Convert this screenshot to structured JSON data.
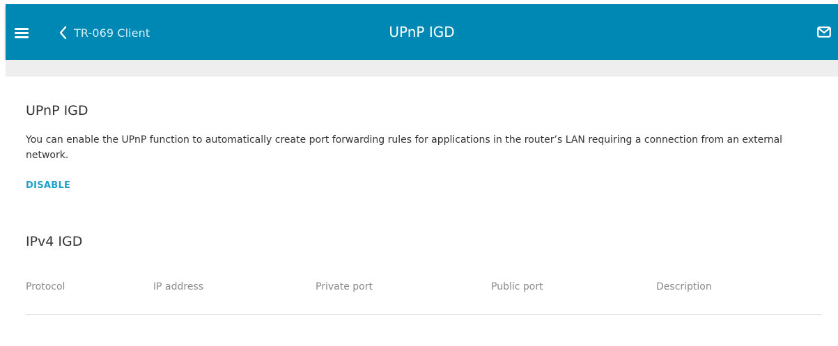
{
  "header": {
    "back_label": "TR-069 Client",
    "title": "UPnP IGD",
    "menu_icon": "hamburger-menu-icon",
    "back_icon": "chevron-left-icon",
    "mail_icon": "envelope-icon",
    "bar_color": "#0088b5"
  },
  "upnp": {
    "title": "UPnP IGD",
    "description": "You can enable the UPnP function to automatically create port forwarding rules for applications in the router’s LAN requiring a connection from an external network.",
    "toggle_label": "DISABLE",
    "accent_color": "#1f9fcc"
  },
  "ipv4": {
    "title": "IPv4 IGD",
    "columns": [
      "Protocol",
      "IP address",
      "Private port",
      "Public port",
      "Description"
    ],
    "rows": []
  }
}
